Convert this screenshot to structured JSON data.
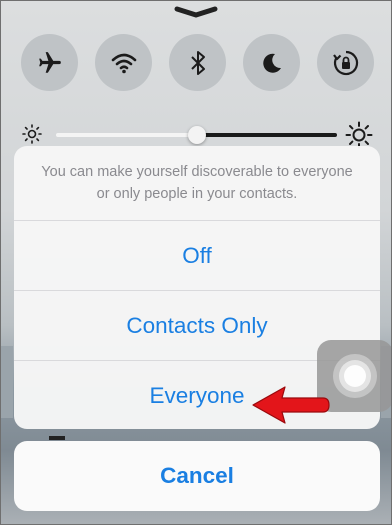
{
  "control_center": {
    "toggles": [
      {
        "icon": "airplane-icon"
      },
      {
        "icon": "wifi-icon"
      },
      {
        "icon": "bluetooth-icon"
      },
      {
        "icon": "moon-icon"
      },
      {
        "icon": "rotation-lock-icon"
      }
    ],
    "brightness": {
      "level": 0.5
    }
  },
  "action_sheet": {
    "message": "You can make yourself discoverable to everyone or only people in your contacts.",
    "options": [
      {
        "label": "Off"
      },
      {
        "label": "Contacts Only"
      },
      {
        "label": "Everyone"
      }
    ],
    "cancel_label": "Cancel"
  },
  "colors": {
    "ios_blue": "#1a7fe2",
    "annotation_arrow": "#e3151a"
  }
}
